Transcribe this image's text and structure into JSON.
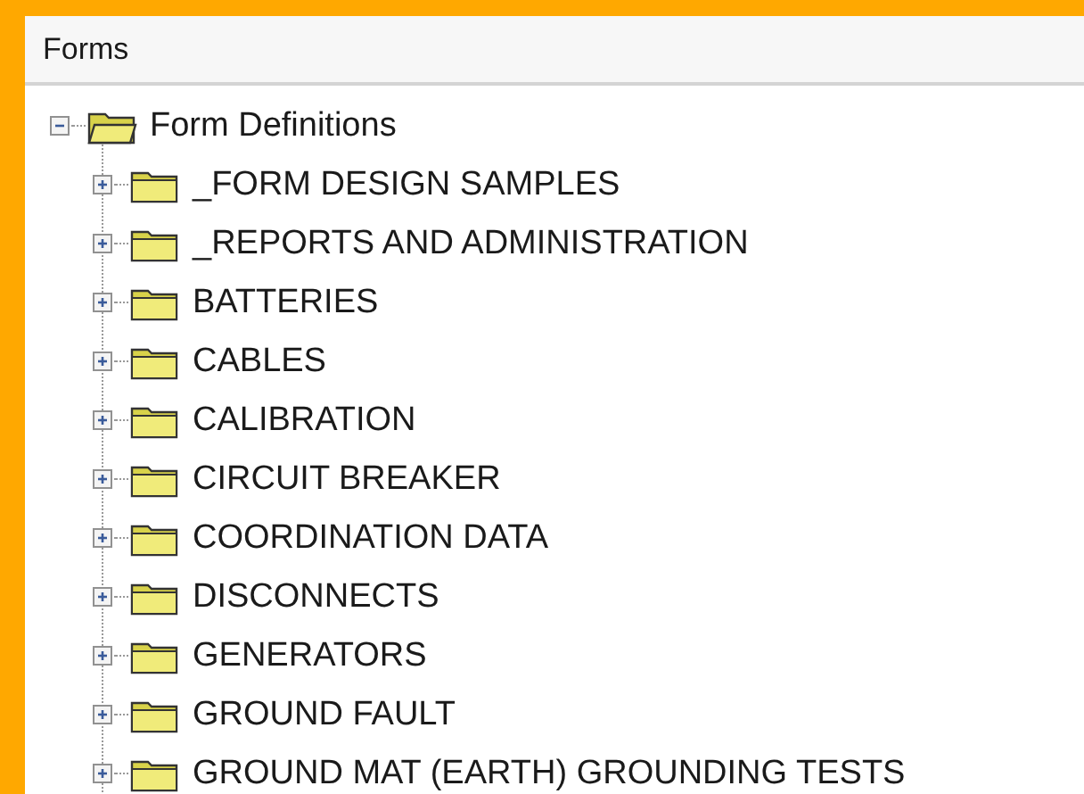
{
  "panel": {
    "title": "Forms"
  },
  "tree": [
    {
      "label": "Form Definitions",
      "expanded": true,
      "children": [
        {
          "label": "_FORM DESIGN SAMPLES",
          "expanded": false
        },
        {
          "label": "_REPORTS AND ADMINISTRATION",
          "expanded": false
        },
        {
          "label": "BATTERIES",
          "expanded": false
        },
        {
          "label": "CABLES",
          "expanded": false
        },
        {
          "label": "CALIBRATION",
          "expanded": false
        },
        {
          "label": "CIRCUIT BREAKER",
          "expanded": false
        },
        {
          "label": "COORDINATION DATA",
          "expanded": false
        },
        {
          "label": "DISCONNECTS",
          "expanded": false
        },
        {
          "label": "GENERATORS",
          "expanded": false
        },
        {
          "label": "GROUND FAULT",
          "expanded": false
        },
        {
          "label": "GROUND MAT (EARTH) GROUNDING TESTS",
          "expanded": false
        }
      ]
    }
  ]
}
